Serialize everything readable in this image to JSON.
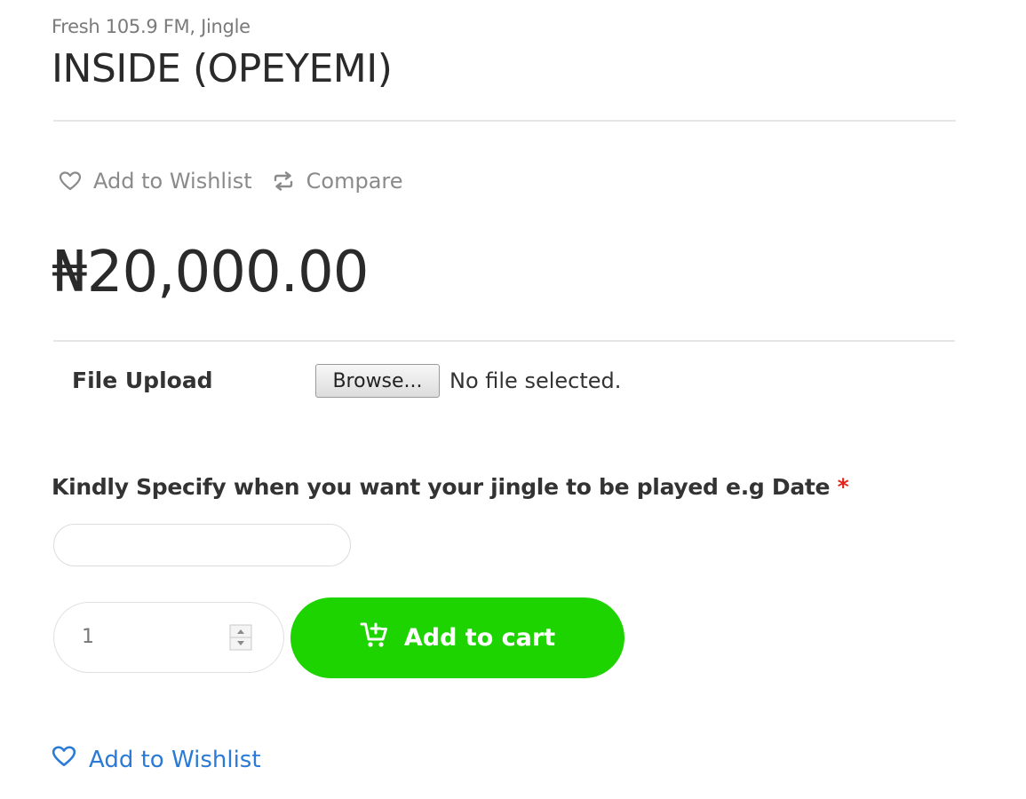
{
  "product": {
    "category": "Fresh 105.9 FM, Jingle",
    "title": "INSIDE (OPEYEMI)",
    "price": "₦20,000.00"
  },
  "actions": {
    "wishlist_label": "Add to Wishlist",
    "compare_label": "Compare"
  },
  "upload": {
    "label": "File Upload",
    "browse_label": "Browse...",
    "status": "No file selected."
  },
  "date_field": {
    "label": "Kindly Specify when you want your jingle to be played e.g Date",
    "required_mark": "*",
    "value": ""
  },
  "quantity": {
    "value": "1"
  },
  "cart": {
    "add_label": "Add to cart"
  },
  "bottom": {
    "wishlist_label": "Add to Wishlist"
  },
  "colors": {
    "accent_green": "#1ed400",
    "link_blue": "#2a7ad6",
    "required_red": "#e2231a"
  },
  "icons": {
    "wishlist": "heart-icon",
    "compare": "compare-arrows-icon",
    "cart": "cart-plus-icon",
    "spinner": "spinner-arrows-icon"
  }
}
